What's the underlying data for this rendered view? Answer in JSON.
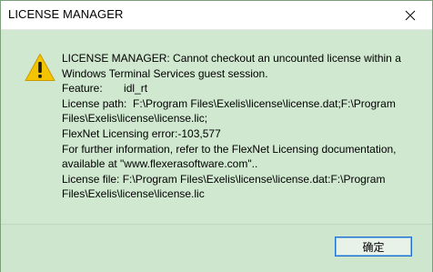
{
  "window": {
    "title": "LICENSE MANAGER"
  },
  "message": {
    "lines": [
      "LICENSE MANAGER: Cannot checkout an uncounted license within a",
      "Windows Terminal Services guest session.",
      "Feature:       idl_rt",
      "License path:  F:\\Program Files\\Exelis\\license\\license.dat;F:\\Program",
      "Files\\Exelis\\license\\license.lic;",
      "FlexNet Licensing error:-103,577",
      "For further information, refer to the FlexNet Licensing documentation,",
      "available at \"www.flexerasoftware.com\"..",
      "License file: F:\\Program Files\\Exelis\\license\\license.dat:F:\\Program",
      "Files\\Exelis\\license\\license.lic"
    ]
  },
  "footer": {
    "ok_label": "确定"
  },
  "icons": {
    "warning": "warning-icon",
    "close": "close-icon"
  },
  "colors": {
    "dialog_background": "#cfe8cf",
    "button_border": "#1f72c9",
    "warning_yellow": "#f5c400"
  }
}
